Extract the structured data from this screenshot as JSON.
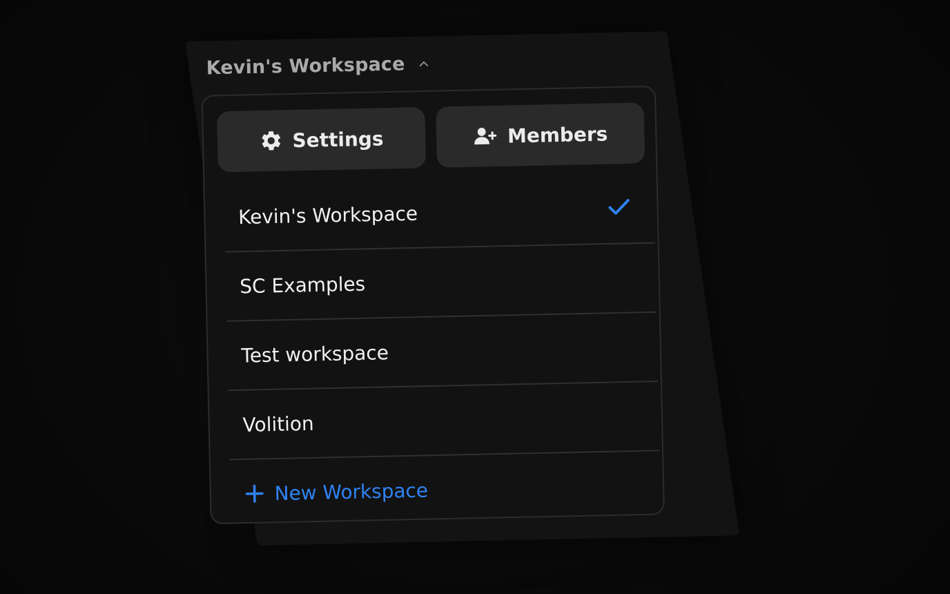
{
  "header": {
    "title": "Kevin's Workspace",
    "chevron_icon": "chevron-up-icon"
  },
  "actions": {
    "settings_label": "Settings",
    "settings_icon": "gear-icon",
    "members_label": "Members",
    "members_icon": "add-user-icon"
  },
  "workspaces": [
    {
      "label": "Kevin's Workspace",
      "selected": true
    },
    {
      "label": "SC Examples",
      "selected": false
    },
    {
      "label": "Test workspace",
      "selected": false
    },
    {
      "label": "Volition",
      "selected": false
    }
  ],
  "new_workspace": {
    "label": "New Workspace",
    "icon": "plus-icon"
  },
  "colors": {
    "accent": "#2f83f2",
    "background": "#090909",
    "panel": "#131313",
    "button": "#2a2a2a"
  }
}
